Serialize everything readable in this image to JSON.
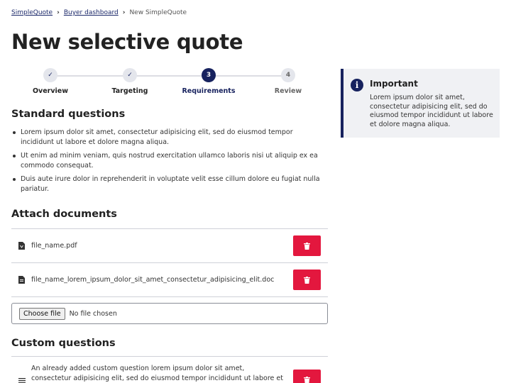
{
  "breadcrumb": {
    "items": [
      "SimpleQuote",
      "Buyer dashboard"
    ],
    "current": "New SimpleQuote"
  },
  "page_title": "New selective quote",
  "stepper": {
    "steps": [
      {
        "label": "Overview",
        "state": "done",
        "marker": "✓"
      },
      {
        "label": "Targeting",
        "state": "done",
        "marker": "✓"
      },
      {
        "label": "Requirements",
        "state": "active",
        "marker": "3"
      },
      {
        "label": "Review",
        "state": "todo",
        "marker": "4"
      }
    ]
  },
  "standard_questions": {
    "title": "Standard questions",
    "bullets": [
      "Lorem ipsum dolor sit amet, consectetur adipisicing elit, sed do eiusmod tempor incididunt ut labore et dolore magna aliqua.",
      "Ut enim ad minim veniam, quis nostrud exercitation ullamco laboris nisi ut aliquip ex ea commodo consequat.",
      "Duis aute irure dolor in reprehenderit in voluptate velit esse cillum dolore eu fugiat nulla pariatur."
    ]
  },
  "attach_documents": {
    "title": "Attach documents",
    "files": [
      {
        "name": "file_name.pdf",
        "icon": "pdf-file-icon"
      },
      {
        "name": "file_name_lorem_ipsum_dolor_sit_amet_consectetur_adipisicing_elit.doc",
        "icon": "doc-file-icon"
      }
    ],
    "file_input": {
      "button": "Choose file",
      "status": "No file chosen"
    }
  },
  "custom_questions": {
    "title": "Custom questions",
    "items": [
      {
        "text": "An already added custom question lorem ipsum dolor sit amet, consectetur adipisicing elit, sed do eiusmod tempor incididunt ut labore et dolore"
      }
    ]
  },
  "important": {
    "title": "Important",
    "body": "Lorem ipsum dolor sit amet, consectetur adipisicing elit, sed do eiusmod tempor incididunt ut labore et dolore magna aliqua."
  },
  "colors": {
    "primary": "#17225e",
    "danger": "#e3173e",
    "panel": "#f0f1f4"
  }
}
